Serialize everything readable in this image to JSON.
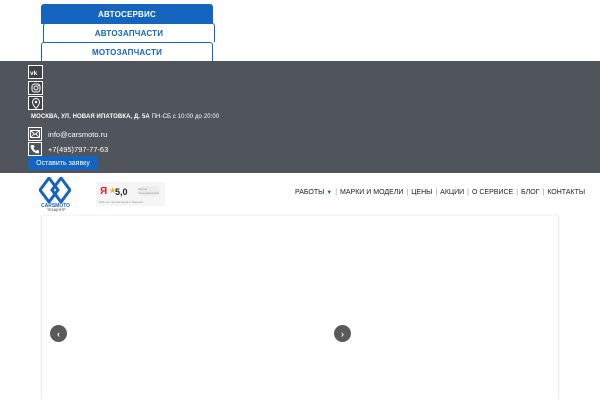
{
  "tabs": [
    {
      "label": "Автосервис",
      "active": true
    },
    {
      "label": "Автозапчасти",
      "active": false
    },
    {
      "label": "Мотозапчасти",
      "active": false
    }
  ],
  "infobar": {
    "social_icons": [
      "vk-icon",
      "instagram-icon",
      "map-pin-icon"
    ],
    "address": "Москва, ул. Новая Ипатовка, д. 5А",
    "hours": "ПН-СБ с 10:00 до 20:00",
    "email": "info@carsmoto.ru",
    "phone": "+7(495)797-77-63",
    "cta_label": "Оставить заявку"
  },
  "header": {
    "logo_text": "CARSMOTO",
    "logo_sub": "ТЕХЦЕНТР",
    "rating_score": "5,0",
    "rating_brand": "Я",
    "rating_badge": "Выбор пользователей",
    "rating_caption": "Рейтинг организаций в Яндексе"
  },
  "nav": {
    "items": [
      "Работы",
      "Марки и модели",
      "Цены",
      "Акции",
      "О сервисе",
      "Блог",
      "Контакты"
    ]
  },
  "slider": {
    "prev_icon": "chevron-left-icon",
    "next_icon": "chevron-right-icon"
  },
  "colors": {
    "accent": "#1565c0",
    "infobar_bg": "#4f555b"
  }
}
